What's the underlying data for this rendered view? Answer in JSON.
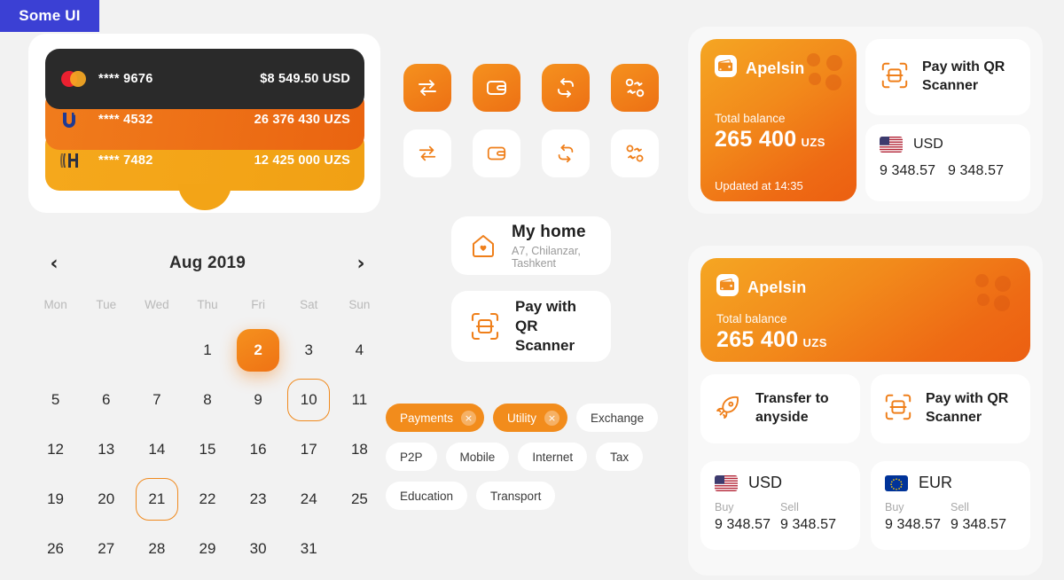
{
  "badge": {
    "label": "Some UI"
  },
  "wallet_cards": {
    "items": [
      {
        "issuer": "mastercard",
        "mask": "**** 9676",
        "amount": "$8 549.50 USD"
      },
      {
        "issuer": "uzcard",
        "mask": "**** 4532",
        "amount": "26 376 430 UZS"
      },
      {
        "issuer": "humo",
        "mask": "**** 7482",
        "amount": "12 425 000 UZS"
      }
    ]
  },
  "calendar": {
    "prev_icon": "chevron-left-icon",
    "next_icon": "chevron-right-icon",
    "title": "Aug 2019",
    "weekdays": [
      "Mon",
      "Tue",
      "Wed",
      "Thu",
      "Fri",
      "Sat",
      "Sun"
    ],
    "leading_blanks": 3,
    "days": [
      1,
      2,
      3,
      4,
      5,
      6,
      7,
      8,
      9,
      10,
      11,
      12,
      13,
      14,
      15,
      16,
      17,
      18,
      19,
      20,
      21,
      22,
      23,
      24,
      25,
      26,
      27,
      28,
      29,
      30,
      31
    ],
    "selected_day": 2,
    "outlined_days": [
      10,
      21
    ]
  },
  "icon_buttons": {
    "solid_row": [
      "transfer-icon",
      "wallet-icon",
      "repeat-icon",
      "swap-icon"
    ],
    "plain_row": [
      "transfer-icon",
      "wallet-icon",
      "repeat-icon",
      "swap-icon"
    ]
  },
  "mid_cards": {
    "home": {
      "icon": "home-heart-icon",
      "title": "My home",
      "subtitle": "A7, Chilanzar,  Tashkent"
    },
    "qr": {
      "icon": "qr-scanner-icon",
      "line1": "Pay with QR",
      "line2": "Scanner"
    }
  },
  "chips": {
    "row1": [
      {
        "label": "Payments",
        "active": true,
        "close_icon": "close-icon"
      },
      {
        "label": "Utility",
        "active": true,
        "close_icon": "close-icon"
      },
      {
        "label": "Exchange",
        "active": false
      }
    ],
    "row2": [
      {
        "label": "P2P",
        "active": false
      },
      {
        "label": "Mobile",
        "active": false
      },
      {
        "label": "Internet",
        "active": false
      },
      {
        "label": "Tax",
        "active": false
      }
    ],
    "row3": [
      {
        "label": "Education",
        "active": false
      },
      {
        "label": "Transport",
        "active": false
      }
    ]
  },
  "panel_top": {
    "apelsin": {
      "logo_icon": "apelsin-wallet-icon",
      "name": "Apelsin",
      "balance_label": "Total balance",
      "balance_value": "265 400",
      "currency": "UZS",
      "updated": "Updated at 14:35"
    },
    "qr": {
      "icon": "qr-scanner-icon",
      "line1": "Pay with QR",
      "line2": "Scanner"
    },
    "usd": {
      "flag": "us-flag-icon",
      "code": "USD",
      "buy": "9 348.57",
      "sell": "9 348.57"
    }
  },
  "panel_bottom": {
    "apelsin": {
      "logo_icon": "apelsin-wallet-icon",
      "name": "Apelsin",
      "balance_label": "Total balance",
      "balance_value": "265 400",
      "currency": "UZS"
    },
    "actions": [
      {
        "icon": "rocket-icon",
        "line1": "Transfer to",
        "line2": "anyside"
      },
      {
        "icon": "qr-scanner-icon",
        "line1": "Pay with QR",
        "line2": "Scanner"
      }
    ],
    "currencies": [
      {
        "flag": "us-flag-icon",
        "code": "USD",
        "buy_label": "Buy",
        "buy_value": "9 348.57",
        "sell_label": "Sell",
        "sell_value": "9 348.57"
      },
      {
        "flag": "eu-flag-icon",
        "code": "EUR",
        "buy_label": "Buy",
        "buy_value": "9 348.57",
        "sell_label": "Sell",
        "sell_value": "9 348.57"
      }
    ]
  },
  "colors": {
    "badge_blue": "#3b40d4",
    "accent_orange": "#f28c1c",
    "accent_orange_dark": "#ec5f11",
    "page_bg": "#f2f2f2",
    "panel_bg": "#f8f8f8",
    "card_dark": "#2a2a2a"
  }
}
